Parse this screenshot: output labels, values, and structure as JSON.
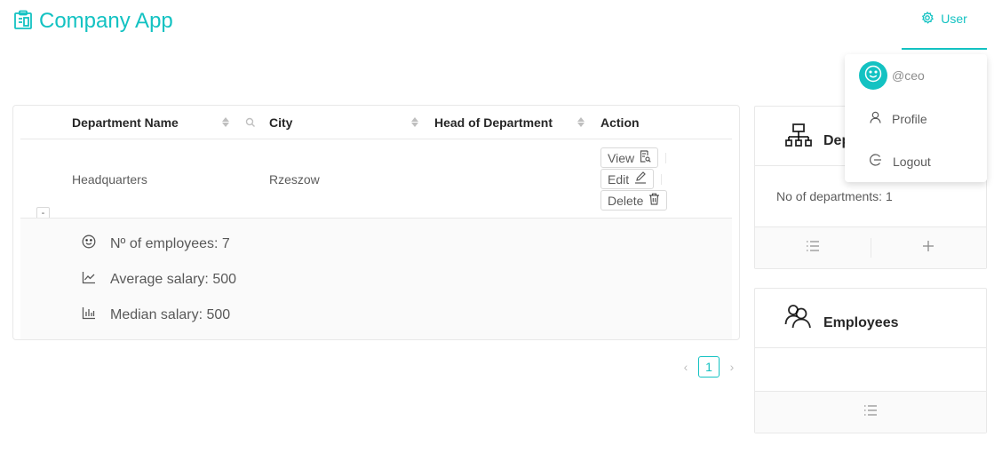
{
  "header": {
    "app_title": "Company App",
    "user_menu_label": "User",
    "accent_color": "#13c2c2"
  },
  "table": {
    "columns": [
      {
        "label": "Department Name",
        "sortable": true,
        "searchable": true
      },
      {
        "label": "City",
        "sortable": true
      },
      {
        "label": "Head of Department",
        "sortable": true
      },
      {
        "label": "Action"
      }
    ],
    "rows": [
      {
        "expand_symbol": "-",
        "department_name": "Headquarters",
        "city": "Rzeszow",
        "head_of_department": "",
        "actions": [
          "View",
          "Edit",
          "Delete"
        ]
      }
    ],
    "expanded": {
      "employees": "Nº of employees: 7",
      "average_salary": "Average salary: 500",
      "median_salary": "Median salary: 500"
    }
  },
  "pagination": {
    "current_page": "1",
    "prev_icon": "left-arrow-icon",
    "next_icon": "right-arrow-icon"
  },
  "departments_card": {
    "title": "Departments",
    "info": "No of departments: 1",
    "icon": "cluster-icon"
  },
  "employees_card": {
    "title": "Employees",
    "icon": "team-icon"
  },
  "user_dropdown": {
    "username": "@ceo",
    "items": [
      "Profile",
      "Logout"
    ]
  }
}
